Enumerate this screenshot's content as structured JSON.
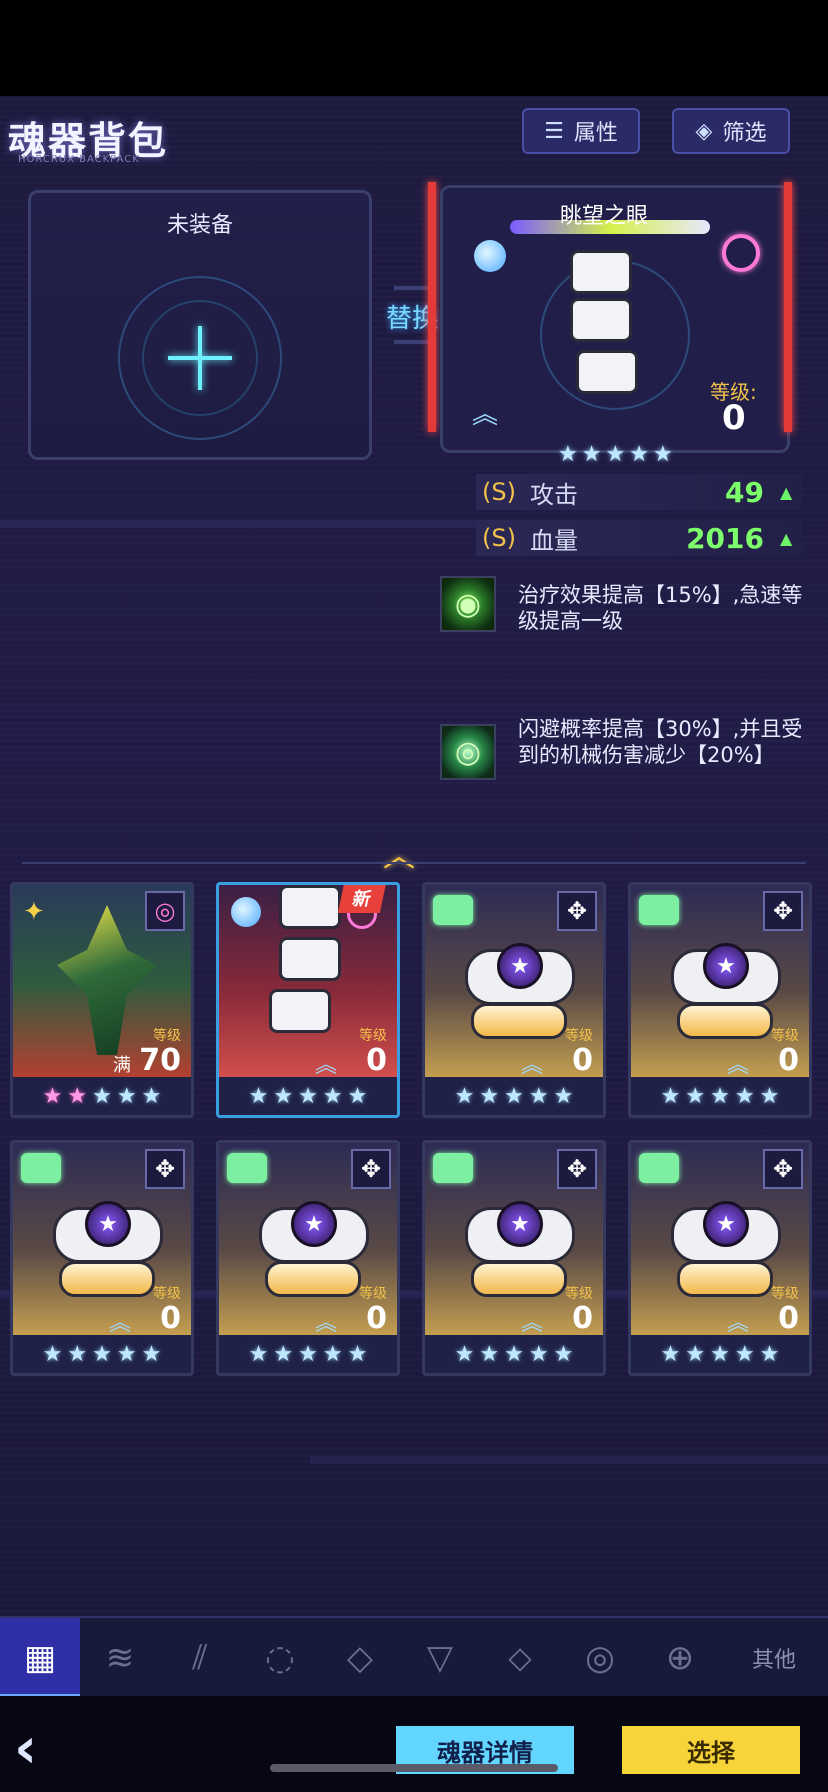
{
  "header": {
    "title": "魂器背包",
    "subtitle": "HORCRUX BACKPACK",
    "attr_button": "属性",
    "filter_button": "筛选"
  },
  "slot": {
    "empty_label": "未装备",
    "swap_label": "替换"
  },
  "equipped": {
    "name": "眺望之眼",
    "level_label": "等级:",
    "level": "0",
    "stars": 5,
    "stats": [
      {
        "grade": "(S)",
        "name": "攻击",
        "value": "49"
      },
      {
        "grade": "(S)",
        "name": "血量",
        "value": "2016"
      }
    ],
    "skills": [
      {
        "icon": "healing-eye-icon",
        "text": "治疗效果提高【15%】,急速等级提高一级"
      },
      {
        "icon": "dodge-eye-icon",
        "text": "闪避概率提高【30%】,并且受到的机械伤害减少【20%】"
      }
    ]
  },
  "inventory": {
    "level_label": "等级",
    "max_label": "满",
    "new_badge": "新",
    "cards": [
      {
        "level": "70",
        "stars_pink": 2,
        "stars": 3,
        "max": true
      },
      {
        "level": "0",
        "stars_pink": 0,
        "stars": 5,
        "new": true,
        "selected": true
      },
      {
        "level": "0",
        "stars_pink": 0,
        "stars": 5
      },
      {
        "level": "0",
        "stars_pink": 0,
        "stars": 5
      },
      {
        "level": "0",
        "stars_pink": 0,
        "stars": 5
      },
      {
        "level": "0",
        "stars_pink": 0,
        "stars": 5
      },
      {
        "level": "0",
        "stars_pink": 0,
        "stars": 5
      },
      {
        "level": "0",
        "stars_pink": 0,
        "stars": 5
      }
    ]
  },
  "tabs": {
    "other_label": "其他"
  },
  "footer": {
    "detail_button": "魂器详情",
    "select_button": "选择"
  },
  "colors": {
    "accent_cyan": "#62d6ff",
    "accent_yellow": "#f7d43a",
    "stat_green": "#7cff6a",
    "level_gold": "#f3c24a"
  }
}
